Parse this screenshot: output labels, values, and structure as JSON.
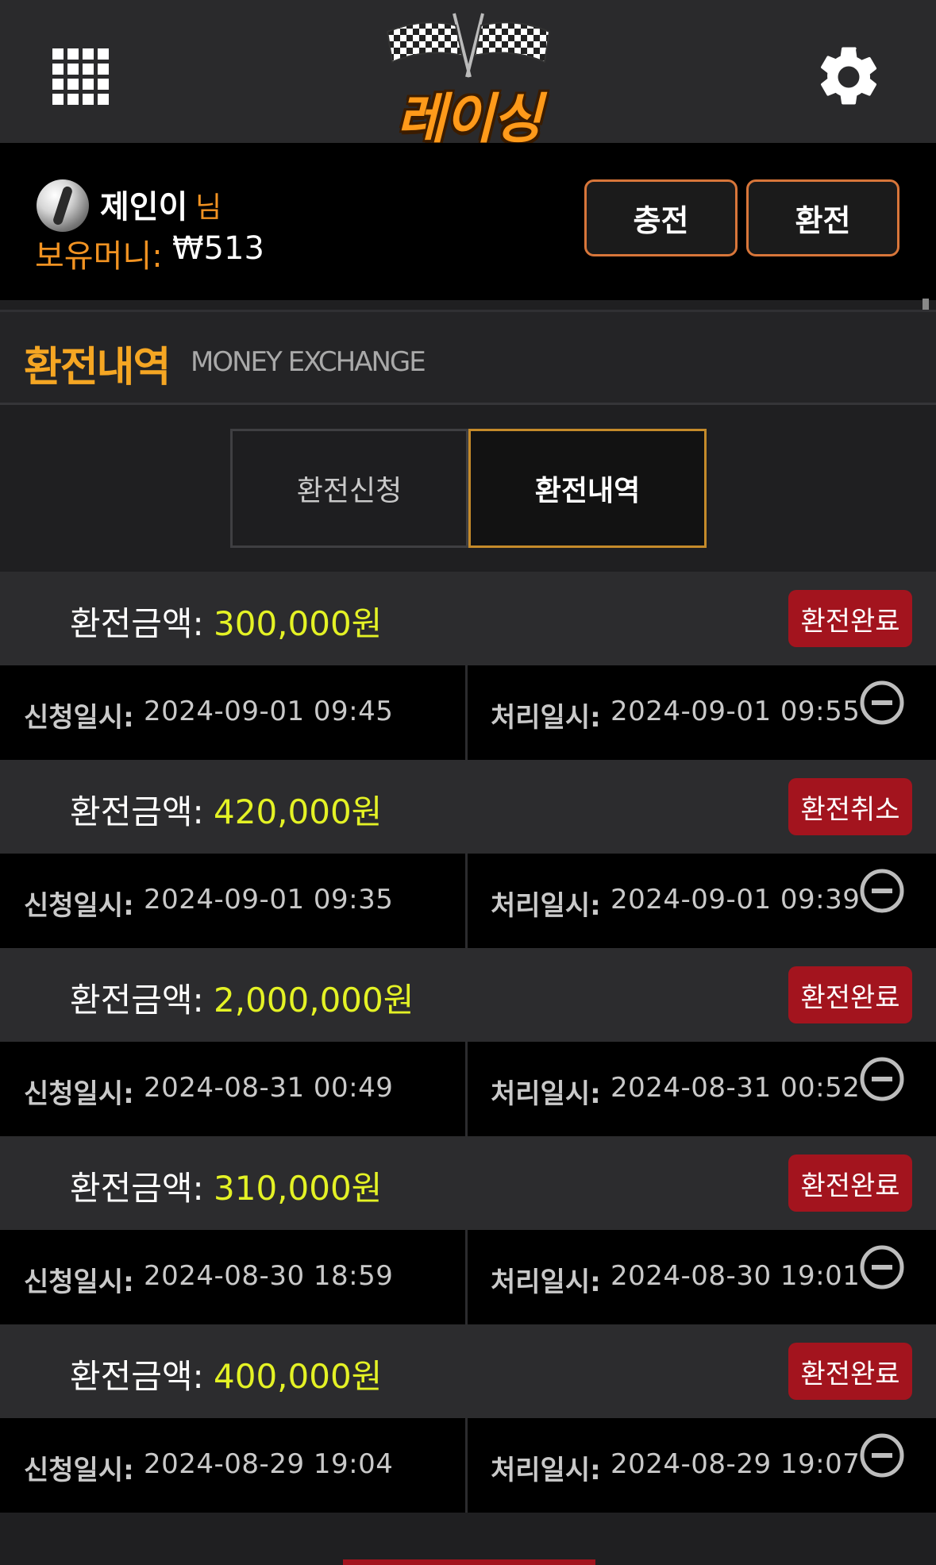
{
  "header": {
    "logo_text": "레이싱",
    "menu_icon": "grid-menu-icon",
    "settings_icon": "gear-icon"
  },
  "user": {
    "name": "제인이",
    "honorific": "님",
    "balance_label": "보유머니:",
    "balance_value": "₩513",
    "deposit_button": "충전",
    "withdraw_button": "환전"
  },
  "section": {
    "title": "환전내역",
    "subtitle": "MONEY EXCHANGE"
  },
  "tabs": [
    {
      "label": "환전신청",
      "active": false
    },
    {
      "label": "환전내역",
      "active": true
    }
  ],
  "labels": {
    "amount": "환전금액:",
    "requested": "신청일시:",
    "processed": "처리일시:"
  },
  "records": [
    {
      "amount": "300,000원",
      "status": "환전완료",
      "requested": "2024-09-01 09:45",
      "processed": "2024-09-01 09:55"
    },
    {
      "amount": "420,000원",
      "status": "환전취소",
      "requested": "2024-09-01 09:35",
      "processed": "2024-09-01 09:39"
    },
    {
      "amount": "2,000,000원",
      "status": "환전완료",
      "requested": "2024-08-31 00:49",
      "processed": "2024-08-31 00:52"
    },
    {
      "amount": "310,000원",
      "status": "환전완료",
      "requested": "2024-08-30 18:59",
      "processed": "2024-08-30 19:01"
    },
    {
      "amount": "400,000원",
      "status": "환전완료",
      "requested": "2024-08-29 19:04",
      "processed": "2024-08-29 19:07"
    }
  ],
  "colors": {
    "accent_orange": "#f5a623",
    "amount_yellow": "#e4f225",
    "status_red": "#a3141e",
    "tab_active_border": "#c48a2a"
  }
}
